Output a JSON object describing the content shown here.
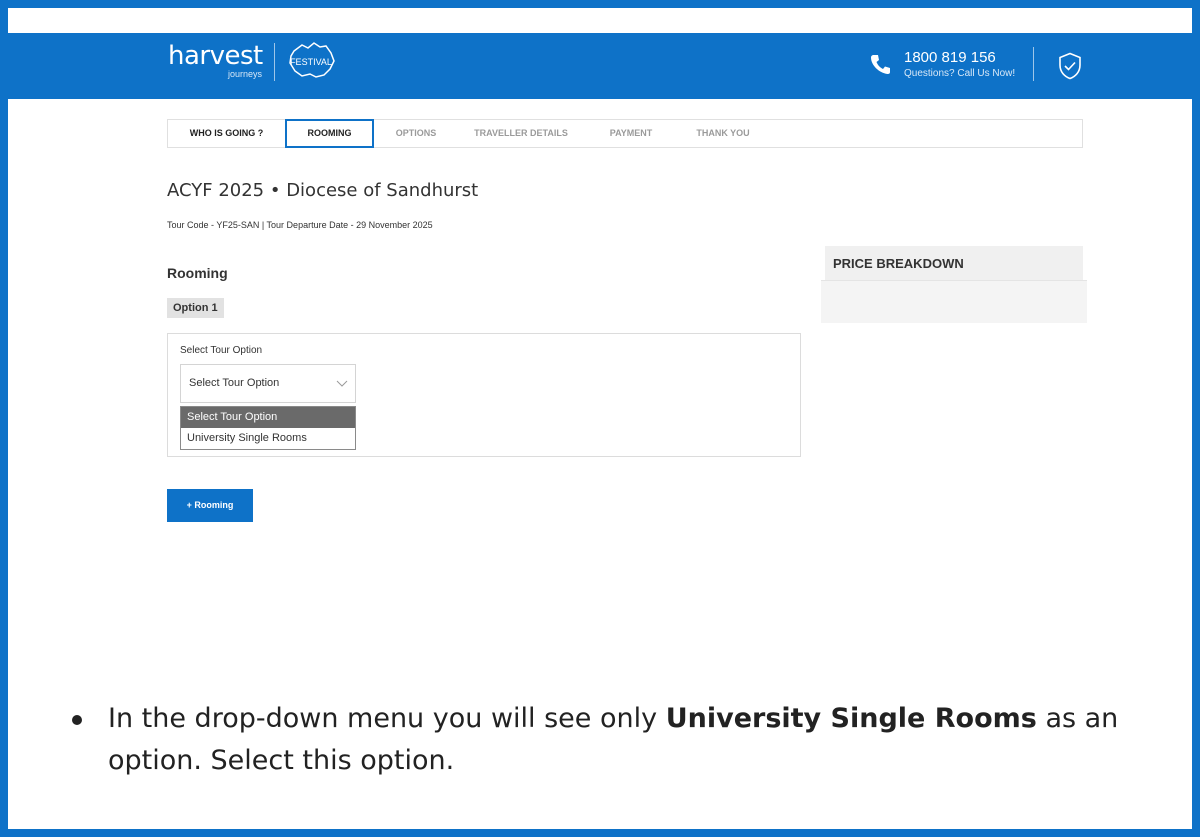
{
  "header": {
    "logo_word": "harvest",
    "logo_sub": "journeys",
    "festival_badge": "FESTIVAL",
    "phone_number": "1800 819 156",
    "phone_caption": "Questions? Call Us Now!",
    "brand_color": "#0e72c8"
  },
  "steps": [
    {
      "label": "WHO IS GOING ?",
      "state": "done"
    },
    {
      "label": "ROOMING",
      "state": "active"
    },
    {
      "label": "OPTIONS",
      "state": "upcoming"
    },
    {
      "label": "TRAVELLER DETAILS",
      "state": "upcoming"
    },
    {
      "label": "PAYMENT",
      "state": "upcoming"
    },
    {
      "label": "THANK YOU",
      "state": "upcoming"
    }
  ],
  "page": {
    "title": "ACYF 2025 • Diocese of Sandhurst",
    "tour_code_line": "Tour Code - YF25-SAN | Tour Departure Date - 29 November 2025"
  },
  "rooming": {
    "section_title": "Rooming",
    "option_tag": "Option 1",
    "field_label": "Select Tour Option",
    "select_value": "Select Tour Option",
    "options": [
      "Select Tour Option",
      "University Single Rooms"
    ],
    "add_button": "+ Rooming"
  },
  "price_panel": {
    "title": "PRICE BREAKDOWN"
  },
  "instruction": {
    "before": "In the drop-down menu you will see only ",
    "bold": "University Single Rooms",
    "after": " as an option. Select this option."
  },
  "icons": {
    "phone": "phone-icon",
    "shield": "shield-check-icon",
    "chevron": "chevron-down-icon"
  }
}
